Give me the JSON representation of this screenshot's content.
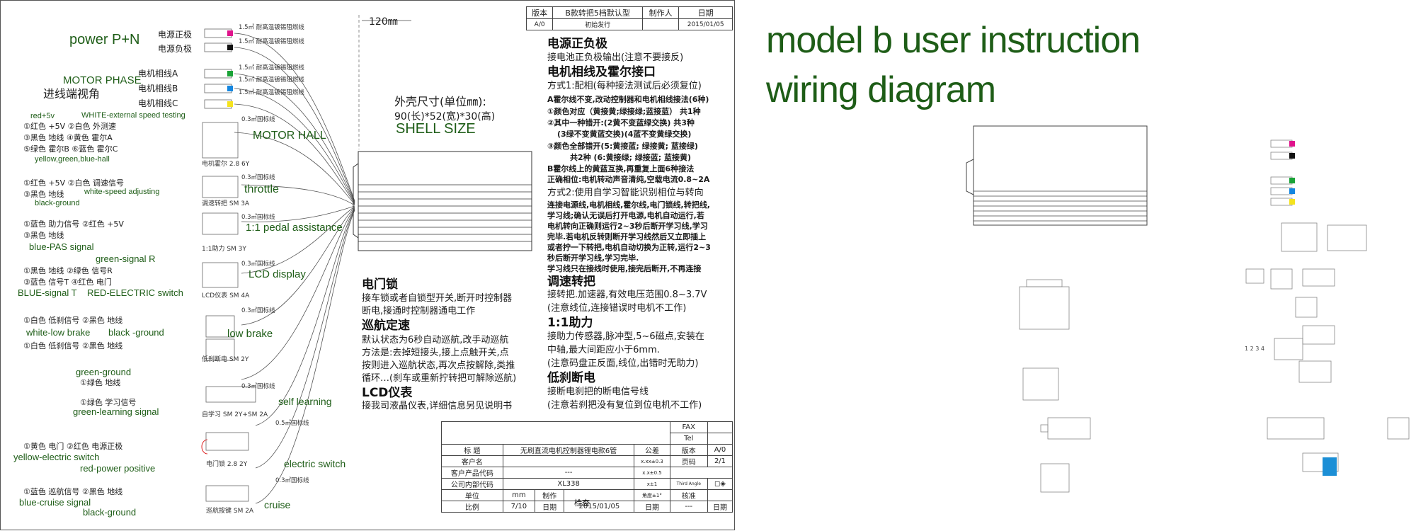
{
  "title_block_top": {
    "ver_label": "版本",
    "ver_value": "A/0",
    "model": "B款转把5档默认型",
    "release": "初始发行",
    "maker_label": "制作人",
    "date_label": "日期",
    "date": "2015/01/05"
  },
  "dimension": "120㎜",
  "wire_labels": {
    "w1": "1.5㎡ 耐高温镀锡阻燃线",
    "w2": "0.3㎡国标线",
    "w3": "0.5㎡国标线"
  },
  "left_labels": {
    "power": "power P+N",
    "power_pos": "电源正极",
    "power_neg": "电源负极",
    "motor_phase": "MOTOR PHASE",
    "view": "进线端视角",
    "phase_a": "电机相线A",
    "phase_b": "电机相线B",
    "phase_c": "电机相线C",
    "red5v": "red+5v",
    "white_ext": "WHITE-external speed testing",
    "hall_l1": "①红色 +5V  ②白色 外测速",
    "hall_l2": "③黑色 地线  ④黄色 霍尔A",
    "hall_l3": "⑤绿色 霍尔B  ⑥蓝色 霍尔C",
    "hall_colors": "yellow,green,blue-hall",
    "motor_hall": "MOTOR HALL",
    "hall_part": "电机霍尔 2.8 6Y",
    "thr_l1": "①红色 +5V  ②白色 调速信号",
    "white_speed": "white-speed adjusting",
    "thr_l2": "③黑色 地线",
    "black_ground": "black-ground",
    "throttle": "throttle",
    "thr_part": "调速转把 SM 3A",
    "pas_l1": "①蓝色 助力信号  ②红色 +5V",
    "pas_l2": "③黑色 地线",
    "blue_pas": "blue-PAS signal",
    "pedal": "1:1 pedal assistance",
    "pas_part": "1:1助力 SM 3Y",
    "green_r": "green-signal R",
    "lcd_l1": "①黑色 地线    ②绿色 信号R",
    "lcd_l2": "③蓝色 信号T   ④红色 电门",
    "blue_t": "BLUE-signal T",
    "red_sw": "RED-ELECTRIC switch",
    "lcd": "LCD display",
    "lcd_part": "LCD仪表 SM 4A",
    "brk_l1": "①白色 低刹信号  ②黑色 地线",
    "white_low": "white-low brake",
    "black_g": "black -ground",
    "brk_l2": "①白色 低刹信号  ②黑色 地线",
    "low_brake": "low brake",
    "brk_part": "低刹断电 SM 2Y",
    "green_ground": "green-ground",
    "learn_l1": "①绿色 地线",
    "learn_l2": "①绿色 学习信号",
    "green_learn": "green-learning signal",
    "self_learn": "self learning",
    "learn_part": "自学习 SM 2Y+SM 2A",
    "es_l1": "①黄色 电门  ②红色 电源正极",
    "yellow_es": "yellow-electric switch",
    "red_pp": "red-power positive",
    "es": "electric switch",
    "es_part": "电门锁 2.8 2Y",
    "cr_l1": "①蓝色 巡航信号  ②黑色 地线",
    "blue_cr": "blue-cruise signal",
    "black_g2": "black-ground",
    "cruise": "cruise",
    "cr_part": "巡航按键 SM 2A"
  },
  "shell": {
    "cn": "外壳尺寸(单位㎜):",
    "dims": "90(长)*52(宽)*30(高)",
    "en": "SHELL SIZE"
  },
  "instructions": {
    "h1": "电源正负极",
    "p1": "接电池正负极输出(注意不要接反)",
    "h2": "电机相线及霍尔接口",
    "p2": "方式1:配相(每种接法测试后必须复位)",
    "p3": "A霍尔线不变,改动控制器和电机相线接法(6种)",
    "p4": "①颜色对应（黄接黄;绿接绿;蓝接蓝） 共1种",
    "p5": "②其中一种错开:(2黄不变蓝绿交换) 共3种",
    "p6": "(3绿不变黄蓝交换)(4蓝不变黄绿交换)",
    "p7": "③颜色全部错开(5:黄接蓝; 绿接黄; 蓝接绿)",
    "p8": "共2种   (6:黄接绿; 绿接蓝; 蓝接黄)",
    "p9": "B霍尔线上的黄蓝互换,再重复上面6种接法",
    "p10": "正确相位:电机转动声音清纯,空载电流0.8~2A",
    "p11": "方式2:使用自学习智能识别相位与转向",
    "p12": "连接电源线,电机相线,霍尔线,电门锁线,转把线,",
    "p13": "学习线;确认无误后打开电源,电机自动运行,若",
    "p14": "电机转向正确则运行2~3秒后断开学习线,学习",
    "p15": "完毕.若电机反转则断开学习线然后又立即插上",
    "p16": "或者拧一下转把,电机自动切换为正转,运行2~3",
    "p17": "秒后断开学习线,学习完毕.",
    "p18": "学习线只在接线时使用,接完后断开,不再连接",
    "h3": "调速转把",
    "p19": "接转把.加速器,有效电压范围0.8~3.7V",
    "p20": "(注意线位,连接错误时电机不工作)",
    "h4": "1:1助力",
    "p21": "接助力传感器,脉冲型,5~6磁点,安装在",
    "p22": "中轴,最大间距应小于6mm.",
    "p23": "(注意码盘正反面,线位,出错时无助力)",
    "h5": "低刹断电",
    "p24": "接断电刹把的断电信号线",
    "p25": "(注意若刹把没有复位到位电机不工作)",
    "h6": "电门锁",
    "p26": "接车锁或者自锁型开关,断开时控制器",
    "p27": "断电,接通时控制器通电工作",
    "h7": "巡航定速",
    "p28": "默认状态为6秒自动巡航,改手动巡航",
    "p29": "方法是:去掉短接头,接上点触开关,点",
    "p30": "按则进入巡航状态,再次点按解除,类推",
    "p31": "循环…(刹车或重新拧转把可解除巡航)",
    "h8": "LCD仪表",
    "p32": "接我司液晶仪表,详细信息另见说明书"
  },
  "title_block": {
    "fax": "FAX",
    "tel": "Tel",
    "title_label": "标 题",
    "title": "无刷直流电机控制器锂电款6管",
    "tol_label": "公差",
    "ver_label": "版本",
    "ver": "A/0",
    "customer": "客户名",
    "page_label": "页码",
    "page": "2/1",
    "tol1": "x.xx±0.3",
    "tol2": "x.x±0.5",
    "tol3": "x±1",
    "tol4": "角度±1°",
    "cust_code": "客户产品代码",
    "dash": "---",
    "internal": "公司内部代码",
    "code": "XL338",
    "third": "Third Angle",
    "unit": "单位",
    "mm": "mm",
    "make": "制作",
    "check": "检查",
    "approve": "核准",
    "scale": "比例",
    "scale_v": "7/10",
    "date_label": "日期",
    "date": "2015/01/05"
  },
  "right": {
    "title1": "model b user instruction",
    "title2": "wiring diagram",
    "num1": "1 2 3 4"
  },
  "colors": {
    "text_green": "#1e5d17",
    "magenta": "#e0138c",
    "green": "#1aa337",
    "blue": "#1486e0",
    "yellow": "#f5e31e",
    "cyan_block": "#1c8fd6"
  }
}
